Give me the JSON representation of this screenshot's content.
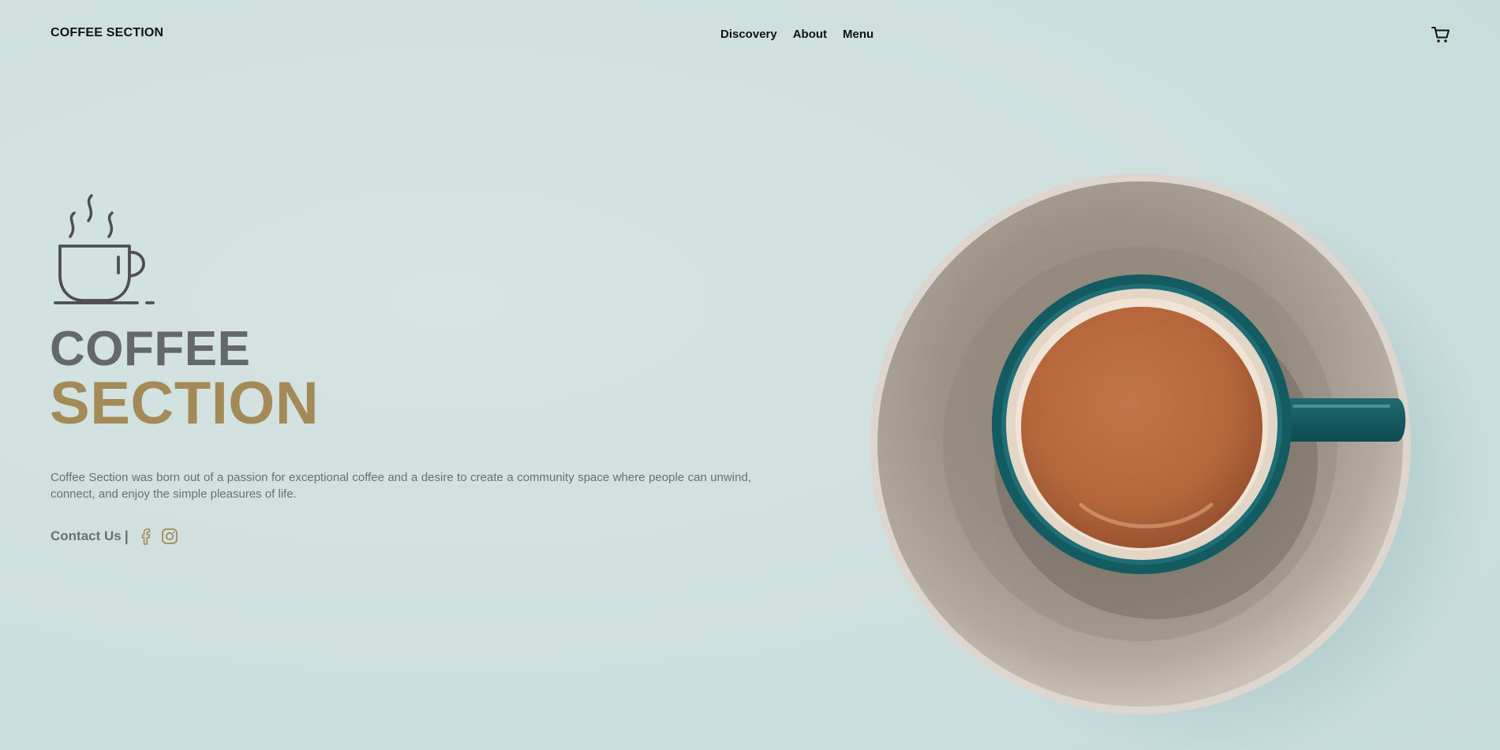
{
  "header": {
    "brand": "COFFEE SECTION",
    "nav": [
      {
        "label": "Discovery"
      },
      {
        "label": "About"
      },
      {
        "label": "Menu"
      }
    ],
    "cart_icon": "cart-icon"
  },
  "hero": {
    "logo_icon": "coffee-cup-icon",
    "title_line1": "COFFEE",
    "title_line2": "SECTION",
    "description": "Coffee Section was born out of a passion for exceptional coffee and a desire to create a community space where people can unwind, connect, and enjoy the simple pleasures of life.",
    "contact_label": "Contact Us",
    "contact_separator": "|",
    "socials": [
      {
        "icon": "facebook-icon"
      },
      {
        "icon": "instagram-icon"
      }
    ],
    "image_icon": "coffee-cup-photo"
  },
  "colors": {
    "background": "#cfe0df",
    "text_dark": "#121212",
    "title_gray": "#656868",
    "accent_gold": "#a48a57",
    "body_text": "#6b6f70"
  }
}
